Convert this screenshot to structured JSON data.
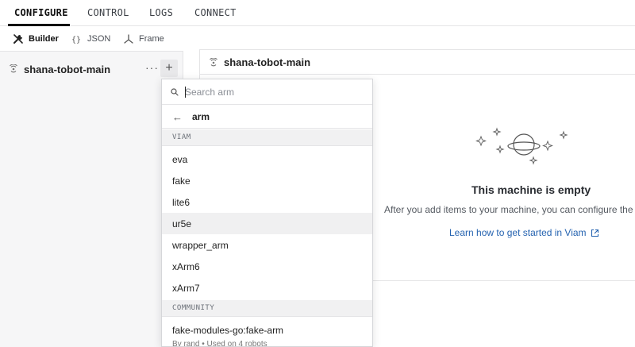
{
  "nav": {
    "tabs": [
      "CONFIGURE",
      "CONTROL",
      "LOGS",
      "CONNECT"
    ]
  },
  "modes": {
    "builder": "Builder",
    "json": "JSON",
    "frame": "Frame"
  },
  "machine": {
    "name": "shana-tobot-main",
    "more": "···",
    "add": "+"
  },
  "main": {
    "header": "shana-tobot-main",
    "empty_title": "This machine is empty",
    "empty_desc": "After you add items to your machine, you can configure the",
    "link": "Learn how to get started in Viam"
  },
  "dropdown": {
    "search_placeholder": "Search arm",
    "search_value": "",
    "back_label": "arm",
    "section_viam": "VIAM",
    "items": [
      "eva",
      "fake",
      "lite6",
      "ur5e",
      "wrapper_arm",
      "xArm6",
      "xArm7"
    ],
    "hovered_item": "ur5e",
    "section_community": "COMMUNITY",
    "community_item": {
      "title": "fake-modules-go:fake-arm",
      "subtitle": "By rand • Used on 4 robots"
    }
  },
  "colors": {
    "link": "#2563b0",
    "panel_bg": "#f6f6f7"
  }
}
